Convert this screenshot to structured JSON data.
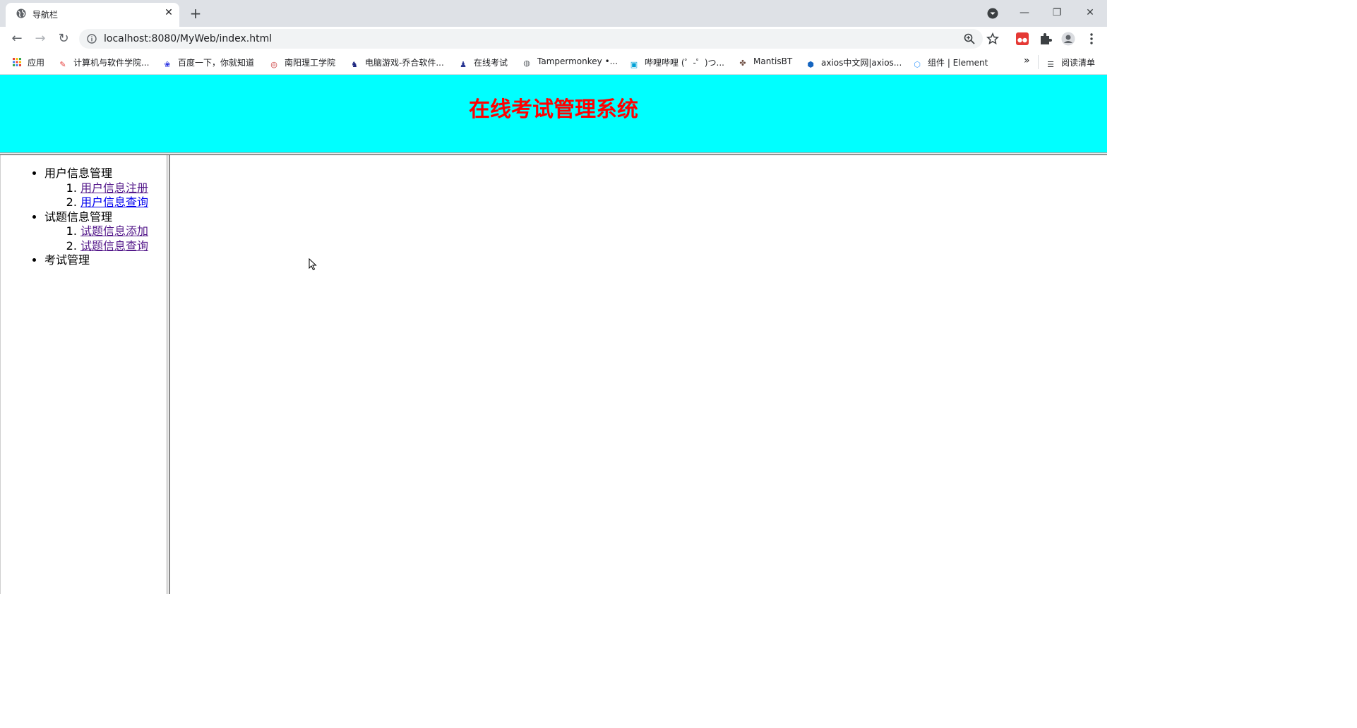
{
  "browser": {
    "tab": {
      "title": "导航栏"
    },
    "address": {
      "url": "localhost:8080/MyWeb/index.html"
    },
    "bookmarks": [
      {
        "label": "应用",
        "icon": "apps-grid-icon"
      },
      {
        "label": "计算机与软件学院...",
        "icon": "pen-icon"
      },
      {
        "label": "百度一下，你就知道",
        "icon": "baidu-paw-icon"
      },
      {
        "label": "南阳理工学院",
        "icon": "school-seal-icon"
      },
      {
        "label": "电脑游戏-乔合软件...",
        "icon": "game-icon"
      },
      {
        "label": "在线考试",
        "icon": "exam-icon"
      },
      {
        "label": "Tampermonkey •...",
        "icon": "globe-icon"
      },
      {
        "label": "哔哩哔哩 (゜-゜)つ...",
        "icon": "bilibili-tv-icon"
      },
      {
        "label": "MantisBT",
        "icon": "mantis-icon"
      },
      {
        "label": "axios中文网|axios...",
        "icon": "hex-h-icon"
      },
      {
        "label": "组件 | Element",
        "icon": "element-icon"
      }
    ],
    "bookmarks_more": "»",
    "reading_list": "阅读清单"
  },
  "page": {
    "title": "在线考试管理系统",
    "menu": [
      {
        "label": "用户信息管理",
        "children": [
          {
            "num": "1.",
            "label": "用户信息注册",
            "visited": true
          },
          {
            "num": "2.",
            "label": "用户信息查询",
            "visited": false
          }
        ]
      },
      {
        "label": "试题信息管理",
        "children": [
          {
            "num": "1.",
            "label": "试题信息添加",
            "visited": true
          },
          {
            "num": "2.",
            "label": "试题信息查询",
            "visited": true
          }
        ]
      },
      {
        "label": "考试管理",
        "children": []
      }
    ]
  }
}
